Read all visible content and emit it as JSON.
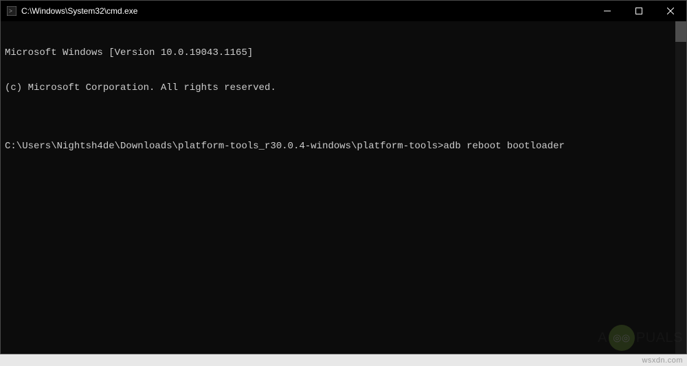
{
  "titlebar": {
    "title": "C:\\Windows\\System32\\cmd.exe"
  },
  "terminal": {
    "line1": "Microsoft Windows [Version 10.0.19043.1165]",
    "line2": "(c) Microsoft Corporation. All rights reserved.",
    "blank": "",
    "prompt": "C:\\Users\\Nightsh4de\\Downloads\\platform-tools_r30.0.4-windows\\platform-tools>",
    "command": "adb reboot bootloader"
  },
  "watermark": {
    "left": "A",
    "right": "PUALS"
  },
  "site": "wsxdn.com"
}
